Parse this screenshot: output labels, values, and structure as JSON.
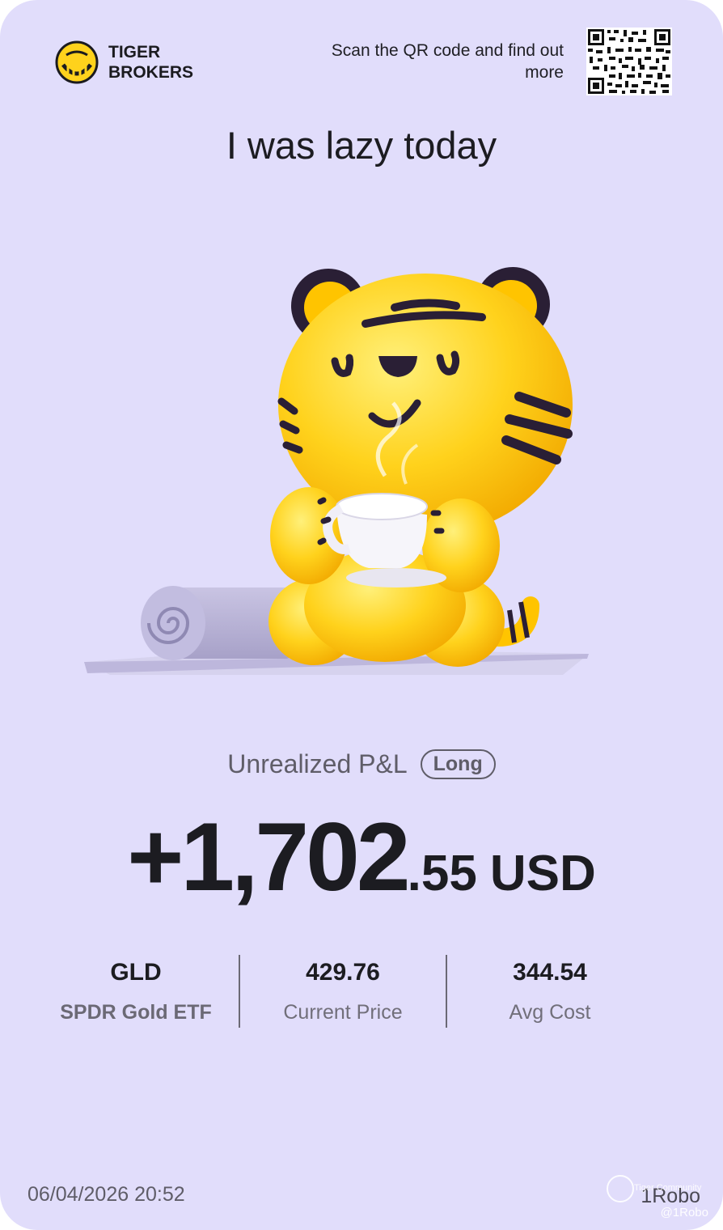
{
  "brand": {
    "line1": "TIGER",
    "line2": "BROKERS"
  },
  "qr": {
    "text": "Scan the QR code and find out more"
  },
  "title": "I was lazy today",
  "pnl": {
    "label": "Unrealized P&L",
    "badge": "Long",
    "integer": "+1,702",
    "decimal": ".55",
    "currency": "USD"
  },
  "stats": [
    {
      "value": "GLD",
      "label": "SPDR Gold ETF"
    },
    {
      "value": "429.76",
      "label": "Current Price"
    },
    {
      "value": "344.54",
      "label": "Avg Cost"
    }
  ],
  "timestamp": "06/04/2026 20:52",
  "username": "1Robo",
  "watermark": {
    "community": "Tiger Community",
    "handle": "@1Robo"
  },
  "colors": {
    "background": "#e1ddfb",
    "tiger": "#ffd21c",
    "text": "#1c1c21"
  }
}
